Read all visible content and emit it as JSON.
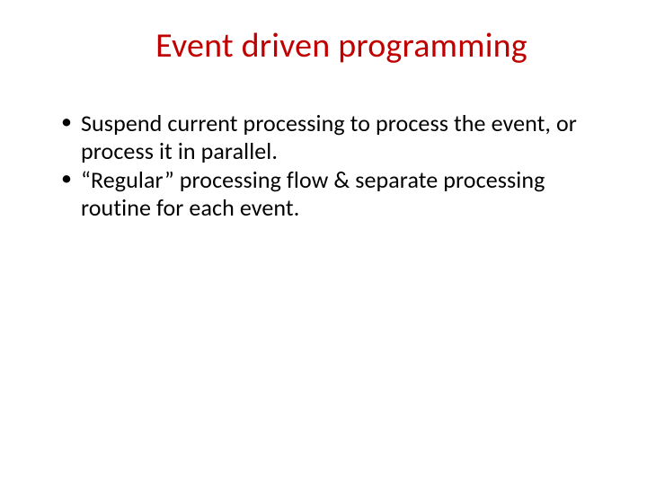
{
  "slide": {
    "title": "Event driven programming",
    "bullets": [
      "Suspend current processing  to process the event, or process it in parallel.",
      "“Regular” processing flow & separate processing routine for each event."
    ]
  }
}
